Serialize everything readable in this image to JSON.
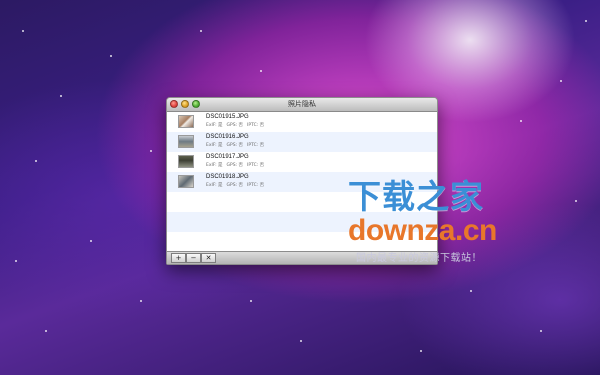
{
  "window": {
    "title": "照片隐私"
  },
  "photos": [
    {
      "filename": "DSC01915.JPG",
      "exif": "ExIF:  是",
      "gps": "GPS:  否",
      "iptc": "IPTC:  否"
    },
    {
      "filename": "DSC01916.JPG",
      "exif": "ExIF:  是",
      "gps": "GPS:  否",
      "iptc": "IPTC:  否"
    },
    {
      "filename": "DSC01917.JPG",
      "exif": "ExIF:  是",
      "gps": "GPS:  否",
      "iptc": "IPTC:  否"
    },
    {
      "filename": "DSC01918.JPG",
      "exif": "ExIF:  是",
      "gps": "GPS:  否",
      "iptc": "IPTC:  否"
    }
  ],
  "toolbar": {
    "add_label": "+",
    "remove_label": "−",
    "clear_label": "✕"
  },
  "watermark": {
    "chinese": "下载之家",
    "domain": "downza.cn",
    "slogan": "国内最专业的资源下载站！"
  },
  "colors": {
    "watermark_blue": "#3b8fd6",
    "watermark_orange": "#e8772b",
    "row_stripe": "#edf3fe"
  }
}
